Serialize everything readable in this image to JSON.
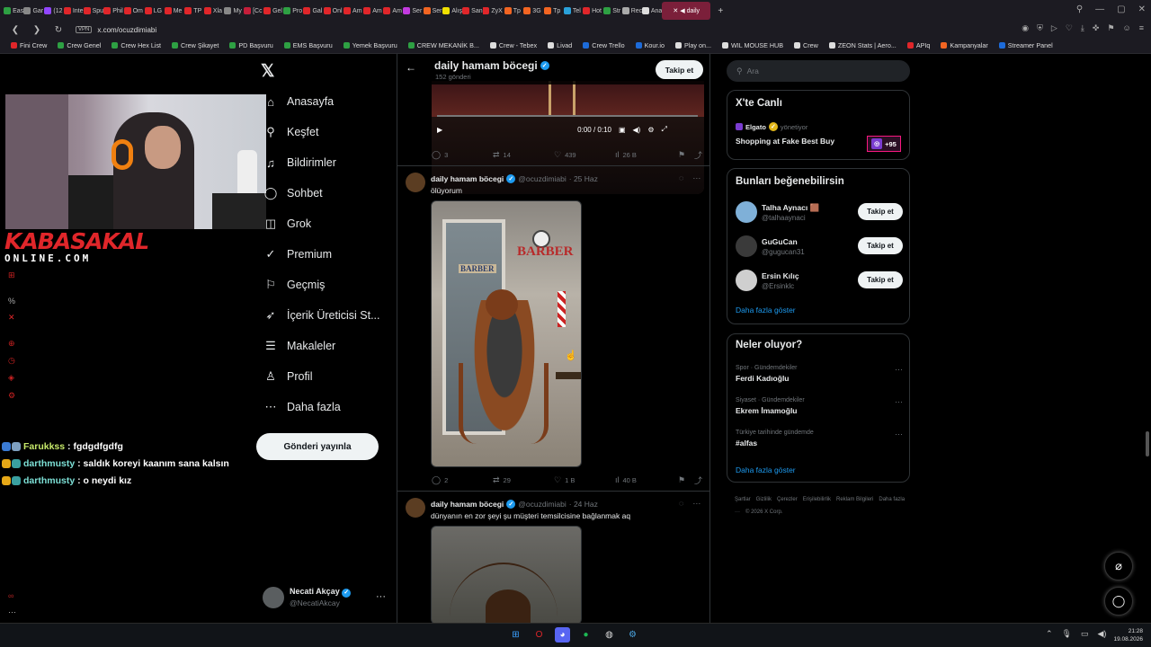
{
  "browser": {
    "tabs": [
      {
        "label": "Eas",
        "color": "#2ea043"
      },
      {
        "label": "Gar",
        "color": "#888888"
      },
      {
        "label": "(12",
        "color": "#9146ff"
      },
      {
        "label": "Inte",
        "color": "#e0262a"
      },
      {
        "label": "Spu",
        "color": "#e0262a"
      },
      {
        "label": "Phil",
        "color": "#e0262a"
      },
      {
        "label": "Om",
        "color": "#e0262a"
      },
      {
        "label": "LG",
        "color": "#e0262a"
      },
      {
        "label": "Me",
        "color": "#e0262a"
      },
      {
        "label": "TP",
        "color": "#e0262a"
      },
      {
        "label": "Xla",
        "color": "#e0262a"
      },
      {
        "label": "My",
        "color": "#888888"
      },
      {
        "label": "[Cc",
        "color": "#c41e3a"
      },
      {
        "label": "Gel",
        "color": "#e0262a"
      },
      {
        "label": "Pro",
        "color": "#2ea043"
      },
      {
        "label": "Gal",
        "color": "#e0262a"
      },
      {
        "label": "Onl",
        "color": "#e0262a"
      },
      {
        "label": "Am",
        "color": "#e0262a"
      },
      {
        "label": "Am",
        "color": "#e0262a"
      },
      {
        "label": "Am",
        "color": "#e0262a"
      },
      {
        "label": "Ser",
        "color": "#c33ae0"
      },
      {
        "label": "Ser",
        "color": "#f26522"
      },
      {
        "label": "Alış",
        "color": "#f0e000"
      },
      {
        "label": "San",
        "color": "#e0262a"
      },
      {
        "label": "ZyX",
        "color": "#e0262a"
      },
      {
        "label": "Tp",
        "color": "#f26522"
      },
      {
        "label": "3G",
        "color": "#f26522"
      },
      {
        "label": "Tp",
        "color": "#f26522"
      },
      {
        "label": "Tel",
        "color": "#2aa1da"
      },
      {
        "label": "Hot",
        "color": "#e0262a"
      },
      {
        "label": "Str",
        "color": "#2ea043"
      },
      {
        "label": "Rec",
        "color": "#aaaaaa"
      },
      {
        "label": "Ana",
        "color": "#dddddd"
      }
    ],
    "active_tab": "daily",
    "url": "x.com/ocuzdimiabi",
    "vpn_label": "VPN",
    "bookmarks": [
      {
        "label": "Fini Crew",
        "color": "#e0262a"
      },
      {
        "label": "Crew Genel",
        "color": "#2ea043"
      },
      {
        "label": "Crew Hex List",
        "color": "#2ea043"
      },
      {
        "label": "Crew Şikayet",
        "color": "#2ea043"
      },
      {
        "label": "PD Başvuru",
        "color": "#2ea043"
      },
      {
        "label": "EMS Başvuru",
        "color": "#2ea043"
      },
      {
        "label": "Yemek Başvuru",
        "color": "#2ea043"
      },
      {
        "label": "CREW MEKANİK B...",
        "color": "#2ea043"
      },
      {
        "label": "Crew - Tebex",
        "color": "#dddddd"
      },
      {
        "label": "Livad",
        "color": "#dddddd"
      },
      {
        "label": "Crew Trello",
        "color": "#1d6bd9"
      },
      {
        "label": "Kour.io",
        "color": "#1d6bd9"
      },
      {
        "label": "Play on...",
        "color": "#dddddd"
      },
      {
        "label": "WIL MOUSE HUB",
        "color": "#dddddd"
      },
      {
        "label": "Crew",
        "color": "#dddddd"
      },
      {
        "label": "ZEON Stats | Aero...",
        "color": "#dddddd"
      },
      {
        "label": "APIq",
        "color": "#e0262a"
      },
      {
        "label": "Kampanyalar",
        "color": "#f26522"
      },
      {
        "label": "Streamer Panel",
        "color": "#1d6bd9"
      }
    ]
  },
  "stream": {
    "brand_main": "KABASAKAL",
    "brand_sub": "ONLINE.COM",
    "chat": [
      {
        "user": "Farukkss",
        "message": "fgdgdfgdfg",
        "color": "#c6e86a"
      },
      {
        "user": "darthmusty",
        "message": "saldık koreyi kaanım sana kalsın",
        "color": "#7de0d6"
      },
      {
        "user": "darthmusty",
        "message": "o neydi kız",
        "color": "#7de0d6"
      }
    ]
  },
  "sidebar": {
    "logo": "𝕏",
    "items": [
      {
        "label": "Anasayfa",
        "icon": "home-icon",
        "glyph": "⌂"
      },
      {
        "label": "Keşfet",
        "icon": "search-icon",
        "glyph": "⚲"
      },
      {
        "label": "Bildirimler",
        "icon": "bell-icon",
        "glyph": "♫"
      },
      {
        "label": "Sohbet",
        "icon": "chat-icon",
        "glyph": "◯"
      },
      {
        "label": "Grok",
        "icon": "grok-icon",
        "glyph": "◫"
      },
      {
        "label": "Premium",
        "icon": "premium-icon",
        "glyph": "✓"
      },
      {
        "label": "Geçmiş",
        "icon": "bookmark-icon",
        "glyph": "⚐"
      },
      {
        "label": "İçerik Üreticisi St...",
        "icon": "rocket-icon",
        "glyph": "➶"
      },
      {
        "label": "Makaleler",
        "icon": "article-icon",
        "glyph": "☰"
      },
      {
        "label": "Profil",
        "icon": "profile-icon",
        "glyph": "♙"
      },
      {
        "label": "Daha fazla",
        "icon": "more-icon",
        "glyph": "⋯"
      }
    ],
    "post_button": "Gönderi yayınla",
    "account": {
      "name": "Necati Akçay",
      "handle": "@NecatiAkcay"
    }
  },
  "profile": {
    "name": "daily hamam böcegi",
    "posts_count": "152 gönderi",
    "follow_label": "Takip et"
  },
  "video1": {
    "time": "0:00 / 0:10",
    "progress": 0.0,
    "stats": {
      "replies": "3",
      "reposts": "14",
      "likes": "439",
      "views": "26 B"
    }
  },
  "posts": [
    {
      "name": "daily hamam böcegi",
      "handle": "@ocuzdimiabi",
      "date": "· 25 Haz",
      "text": "ölüyorum",
      "image_text": {
        "sign_main": "BARBER",
        "sign_door": "BARBER"
      },
      "stats": {
        "replies": "2",
        "reposts": "29",
        "likes": "1 B",
        "views": "40 B"
      }
    },
    {
      "name": "daily hamam böcegi",
      "handle": "@ocuzdimiabi",
      "date": "· 24 Haz",
      "text": "dünyanın en zor şeyi şu müşteri temsilcisine bağlanmak aq"
    }
  ],
  "right": {
    "search_placeholder": "Ara",
    "live": {
      "title": "X'te Canlı",
      "host": "Elgato",
      "host_role": "yönetiyor",
      "stream_title": "Shopping at Fake Best Buy",
      "viewer_extra": "+95"
    },
    "suggestions": {
      "title": "Bunları beğenebilirsin",
      "items": [
        {
          "name": "Talha Aynacı 🟫",
          "handle": "@talhaaynaci",
          "avatar_color": "#7fb0d8"
        },
        {
          "name": "GuGuCan",
          "handle": "@gugucan31",
          "avatar_color": "#3a3a3a"
        },
        {
          "name": "Ersin Kılıç",
          "handle": "@Ersinklc",
          "avatar_color": "#cfcfcf"
        }
      ],
      "follow_label": "Takip et",
      "more": "Daha fazla göster"
    },
    "trends": {
      "title": "Neler oluyor?",
      "items": [
        {
          "category": "Spor · Gündemdekiler",
          "topic": "Ferdi Kadıoğlu"
        },
        {
          "category": "Siyaset · Gündemdekiler",
          "topic": "Ekrem İmamoğlu"
        },
        {
          "category": "Türkiye tarihinde gündemde",
          "topic": "#alfas"
        }
      ],
      "more": "Daha fazla göster"
    },
    "footer": [
      "Şartlar",
      "Gizlilik",
      "Çerezler",
      "Erişilebilirlik",
      "Reklam Bilgileri",
      "Daha fazla ···",
      "© 2026 X Corp."
    ]
  },
  "taskbar": {
    "time": "21:28",
    "date": "19.08.2026"
  }
}
